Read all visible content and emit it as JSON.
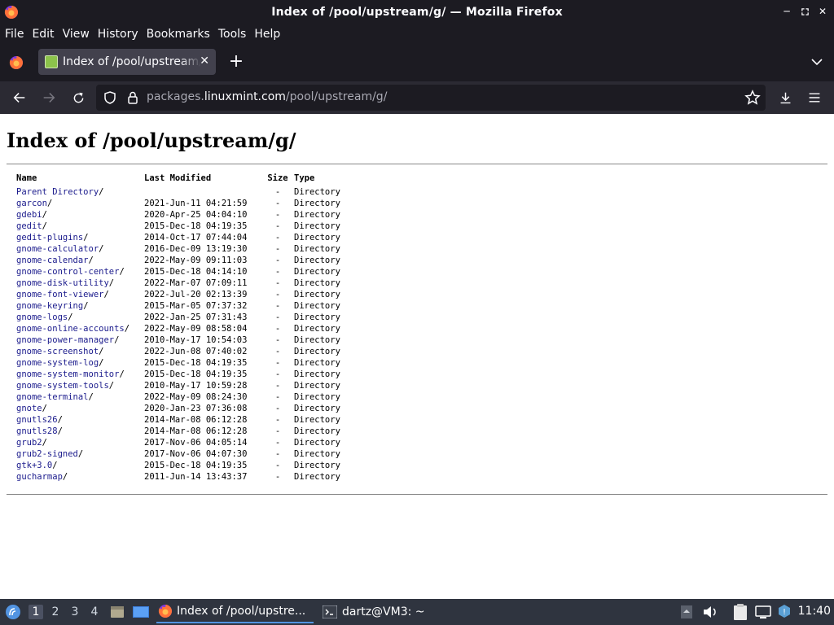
{
  "window": {
    "title": "Index of /pool/upstream/g/ — Mozilla Firefox"
  },
  "menu": {
    "items": [
      {
        "label": "File"
      },
      {
        "label": "Edit"
      },
      {
        "label": "View"
      },
      {
        "label": "History"
      },
      {
        "label": "Bookmarks"
      },
      {
        "label": "Tools"
      },
      {
        "label": "Help"
      }
    ]
  },
  "tabs": [
    {
      "title": "Index of /pool/upstream/g/",
      "active": true
    }
  ],
  "urlbar": {
    "domain": "packages.",
    "host": "linuxmint.com",
    "path": "/pool/upstream/g/"
  },
  "page": {
    "heading": "Index of /pool/upstream/g/",
    "columns": {
      "name": "Name",
      "modified": "Last Modified",
      "size": "Size",
      "type": "Type"
    },
    "parent": {
      "name": "Parent Directory",
      "suffix": "/",
      "modified": "",
      "size": "-",
      "type": "Directory"
    },
    "entries": [
      {
        "name": "garcon",
        "suffix": "/",
        "modified": "2021-Jun-11 04:21:59",
        "size": "-",
        "type": "Directory"
      },
      {
        "name": "gdebi",
        "suffix": "/",
        "modified": "2020-Apr-25 04:04:10",
        "size": "-",
        "type": "Directory"
      },
      {
        "name": "gedit",
        "suffix": "/",
        "modified": "2015-Dec-18 04:19:35",
        "size": "-",
        "type": "Directory"
      },
      {
        "name": "gedit-plugins",
        "suffix": "/",
        "modified": "2014-Oct-17 07:44:04",
        "size": "-",
        "type": "Directory"
      },
      {
        "name": "gnome-calculator",
        "suffix": "/",
        "modified": "2016-Dec-09 13:19:30",
        "size": "-",
        "type": "Directory"
      },
      {
        "name": "gnome-calendar",
        "suffix": "/",
        "modified": "2022-May-09 09:11:03",
        "size": "-",
        "type": "Directory"
      },
      {
        "name": "gnome-control-center",
        "suffix": "/",
        "modified": "2015-Dec-18 04:14:10",
        "size": "-",
        "type": "Directory"
      },
      {
        "name": "gnome-disk-utility",
        "suffix": "/",
        "modified": "2022-Mar-07 07:09:11",
        "size": "-",
        "type": "Directory"
      },
      {
        "name": "gnome-font-viewer",
        "suffix": "/",
        "modified": "2022-Jul-20 02:13:39",
        "size": "-",
        "type": "Directory"
      },
      {
        "name": "gnome-keyring",
        "suffix": "/",
        "modified": "2015-Mar-05 07:37:32",
        "size": "-",
        "type": "Directory"
      },
      {
        "name": "gnome-logs",
        "suffix": "/",
        "modified": "2022-Jan-25 07:31:43",
        "size": "-",
        "type": "Directory"
      },
      {
        "name": "gnome-online-accounts",
        "suffix": "/",
        "modified": "2022-May-09 08:58:04",
        "size": "-",
        "type": "Directory"
      },
      {
        "name": "gnome-power-manager",
        "suffix": "/",
        "modified": "2010-May-17 10:54:03",
        "size": "-",
        "type": "Directory"
      },
      {
        "name": "gnome-screenshot",
        "suffix": "/",
        "modified": "2022-Jun-08 07:40:02",
        "size": "-",
        "type": "Directory"
      },
      {
        "name": "gnome-system-log",
        "suffix": "/",
        "modified": "2015-Dec-18 04:19:35",
        "size": "-",
        "type": "Directory"
      },
      {
        "name": "gnome-system-monitor",
        "suffix": "/",
        "modified": "2015-Dec-18 04:19:35",
        "size": "-",
        "type": "Directory"
      },
      {
        "name": "gnome-system-tools",
        "suffix": "/",
        "modified": "2010-May-17 10:59:28",
        "size": "-",
        "type": "Directory"
      },
      {
        "name": "gnome-terminal",
        "suffix": "/",
        "modified": "2022-May-09 08:24:30",
        "size": "-",
        "type": "Directory"
      },
      {
        "name": "gnote",
        "suffix": "/",
        "modified": "2020-Jan-23 07:36:08",
        "size": "-",
        "type": "Directory"
      },
      {
        "name": "gnutls26",
        "suffix": "/",
        "modified": "2014-Mar-08 06:12:28",
        "size": "-",
        "type": "Directory"
      },
      {
        "name": "gnutls28",
        "suffix": "/",
        "modified": "2014-Mar-08 06:12:28",
        "size": "-",
        "type": "Directory"
      },
      {
        "name": "grub2",
        "suffix": "/",
        "modified": "2017-Nov-06 04:05:14",
        "size": "-",
        "type": "Directory"
      },
      {
        "name": "grub2-signed",
        "suffix": "/",
        "modified": "2017-Nov-06 04:07:30",
        "size": "-",
        "type": "Directory"
      },
      {
        "name": "gtk+3.0",
        "suffix": "/",
        "modified": "2015-Dec-18 04:19:35",
        "size": "-",
        "type": "Directory"
      },
      {
        "name": "gucharmap",
        "suffix": "/",
        "modified": "2011-Jun-14 13:43:37",
        "size": "-",
        "type": "Directory"
      }
    ]
  },
  "taskbar": {
    "workspaces": [
      "1",
      "2",
      "3",
      "4"
    ],
    "active_workspace": "1",
    "tasks": [
      {
        "label": "Index of /pool/upstre...",
        "icon": "firefox-icon",
        "active": true
      },
      {
        "label": "dartz@VM3: ~",
        "icon": "terminal-icon",
        "active": false
      }
    ],
    "clock": "11:40"
  },
  "colors": {
    "chrome_dark": "#1c1b22",
    "toolbar": "#2b2a33",
    "tab_active": "#42414d",
    "link": "#1a1a8c",
    "taskbar": "#2f343f",
    "task_active_underline": "#5294e2"
  }
}
